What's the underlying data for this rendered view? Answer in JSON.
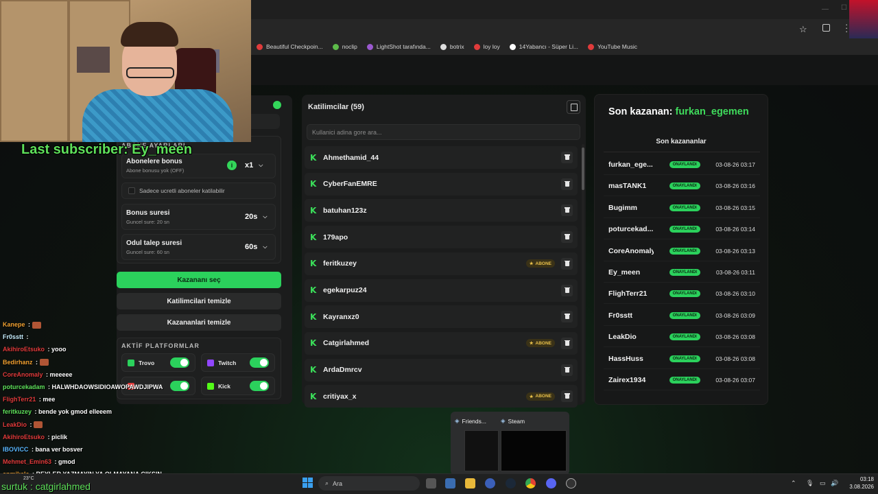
{
  "browser": {
    "bookmarks": [
      {
        "label": "Beautiful Checkpoin...",
        "color": "#e03b3b"
      },
      {
        "label": "noclip",
        "color": "#5dbb4a"
      },
      {
        "label": "LightShot tarafında...",
        "color": "#9b59d0"
      },
      {
        "label": "botrix",
        "color": "#dddddd"
      },
      {
        "label": "loy loy",
        "color": "#e03b3b"
      },
      {
        "label": "14Yabancı - Süper Li...",
        "color": "#ffffff"
      },
      {
        "label": "YouTube Music",
        "color": "#e03b3b"
      }
    ]
  },
  "overlay": {
    "last_subscriber": "Last subscriber: Ey_meen",
    "bottom_text": "surtuk : catgirlahmed"
  },
  "settings": {
    "section_title": "ABONE AYARLARI",
    "subscriber_bonus": {
      "title": "Abonelere bonus",
      "subtitle": "Abone bonusu yok (OFF)",
      "value": "x1"
    },
    "paid_only": {
      "label": "Sadece ucretli aboneler katilabilir",
      "checked": false
    },
    "bonus_duration": {
      "title": "Bonus suresi",
      "subtitle": "Guncel sure: 20 sn",
      "value": "20s"
    },
    "claim_duration": {
      "title": "Odul talep suresi",
      "subtitle": "Guncel sure: 60 sn",
      "value": "60s"
    },
    "pick_winner": "Kazananı seç",
    "clear_participants": "Katilimcilari temizle",
    "clear_winners": "Kazananlari temizle",
    "platforms_title": "AKTİF PLATFORMLAR",
    "platforms": [
      {
        "name": "Trovo",
        "enabled": true,
        "color": "#2bd15c"
      },
      {
        "name": "Twitch",
        "enabled": true,
        "color": "#9146ff"
      },
      {
        "name": "",
        "enabled": true,
        "color": "#e03b3b"
      },
      {
        "name": "Kick",
        "enabled": true,
        "color": "#53fc18"
      }
    ]
  },
  "participants": {
    "title": "Katilimcilar (59)",
    "search_placeholder": "Kullanici adina gore ara...",
    "subscriber_badge": "ABONE",
    "rows": [
      {
        "name": "Ahmethamid_44",
        "subscriber": false
      },
      {
        "name": "CyberFanEMRE",
        "subscriber": false
      },
      {
        "name": "batuhan123z",
        "subscriber": false
      },
      {
        "name": "179apo",
        "subscriber": false
      },
      {
        "name": "feritkuzey",
        "subscriber": true
      },
      {
        "name": "egekarpuz24",
        "subscriber": false
      },
      {
        "name": "Kayranxz0",
        "subscriber": false
      },
      {
        "name": "Catgirlahmed",
        "subscriber": true
      },
      {
        "name": "ArdaDmrcv",
        "subscriber": false
      },
      {
        "name": "critiyax_x",
        "subscriber": true
      }
    ]
  },
  "winners": {
    "last_winner_label": "Son kazanan:",
    "last_winner_name": "furkan_egemen",
    "list_title": "Son kazananlar",
    "status": "ONAYLANDI",
    "rows": [
      {
        "name": "furkan_ege...",
        "time": "03-08-26 03:17"
      },
      {
        "name": "masTANK1",
        "time": "03-08-26 03:16"
      },
      {
        "name": "Bugimm",
        "time": "03-08-26 03:15"
      },
      {
        "name": "poturcekad...",
        "time": "03-08-26 03:14"
      },
      {
        "name": "CoreAnomaly",
        "time": "03-08-26 03:13"
      },
      {
        "name": "Ey_meen",
        "time": "03-08-26 03:11"
      },
      {
        "name": "FlighTerr21",
        "time": "03-08-26 03:10"
      },
      {
        "name": "Fr0sstt",
        "time": "03-08-26 03:09"
      },
      {
        "name": "LeakDio",
        "time": "03-08-26 03:08"
      },
      {
        "name": "HassHuss",
        "time": "03-08-26 03:08"
      },
      {
        "name": "Zairex1934",
        "time": "03-08-26 03:07"
      }
    ]
  },
  "chat": [
    {
      "user": "Kanepe",
      "color": "#f0a030",
      "msg": "",
      "emote": true
    },
    {
      "user": "Fr0sstt",
      "color": "#c8f0ff",
      "msg": "",
      "emote": false
    },
    {
      "user": "AkihiroEtsuko",
      "color": "#e03b3b",
      "msg": "yooo",
      "emote": false
    },
    {
      "user": "Bedirhanz",
      "color": "#f0a030",
      "msg": "",
      "emote": true
    },
    {
      "user": "CoreAnomaly",
      "color": "#e03b3b",
      "msg": "meeeee",
      "emote": false
    },
    {
      "user": "poturcekadam",
      "color": "#5ee05a",
      "msg": "HALWHDAOWSIDIOAWOPAWDJIPWA",
      "emote": false
    },
    {
      "user": "FlighTerr21",
      "color": "#e03b3b",
      "msg": "mee",
      "emote": false
    },
    {
      "user": "feritkuzey",
      "color": "#5ee05a",
      "msg": "bende yok gmod elleeem",
      "emote": false
    },
    {
      "user": "LeakDio",
      "color": "#e03b3b",
      "msg": "",
      "emote": true
    },
    {
      "user": "AkihiroEtsuko",
      "color": "#e03b3b",
      "msg": "piclik",
      "emote": false
    },
    {
      "user": "IBOVICC",
      "color": "#5ab8ff",
      "msg": "bana ver bosver",
      "emote": false
    },
    {
      "user": "Mehmet_Emin63",
      "color": "#e03b3b",
      "msg": "gmod",
      "emote": false
    },
    {
      "user": "enmikele",
      "color": "#f0a030",
      "msg": "BEYLER YAZMAYIN YA OLMAYANA CIKSIN",
      "emote": false
    }
  ],
  "taskbar": {
    "search_placeholder": "Ara",
    "time": "03:18",
    "date": "3.08.2026",
    "weather": "23°C",
    "preview_items": [
      "Friends...",
      "Steam"
    ]
  }
}
